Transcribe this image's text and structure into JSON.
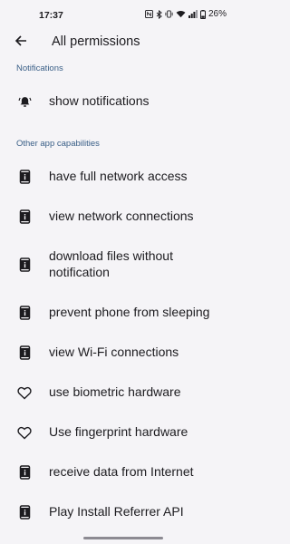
{
  "status_bar": {
    "time": "17:37",
    "battery": "26%",
    "icons": [
      "nfc-icon",
      "bluetooth-icon",
      "vibrate-icon",
      "wifi-icon",
      "signal-icon",
      "battery-icon"
    ]
  },
  "app_bar": {
    "back_icon": "arrow-back-icon",
    "title": "All permissions"
  },
  "sections": [
    {
      "header": "Notifications",
      "items": [
        {
          "label": "show notifications",
          "icon": "bell-icon"
        }
      ]
    },
    {
      "header": "Other app capabilities",
      "items": [
        {
          "label": "have full network access",
          "icon": "info-phone-icon"
        },
        {
          "label": "view network connections",
          "icon": "info-phone-icon"
        },
        {
          "label": "download files without notification",
          "icon": "info-phone-icon"
        },
        {
          "label": "prevent phone from sleeping",
          "icon": "info-phone-icon"
        },
        {
          "label": "view Wi-Fi connections",
          "icon": "info-phone-icon"
        },
        {
          "label": "use biometric hardware",
          "icon": "heart-icon"
        },
        {
          "label": "Use fingerprint hardware",
          "icon": "heart-icon"
        },
        {
          "label": "receive data from Internet",
          "icon": "info-phone-icon"
        },
        {
          "label": "Play Install Referrer API",
          "icon": "info-phone-icon"
        }
      ]
    }
  ],
  "colors": {
    "background": "#f5f4f7",
    "section_header": "#3a5f87",
    "text": "#1c1b1f"
  }
}
